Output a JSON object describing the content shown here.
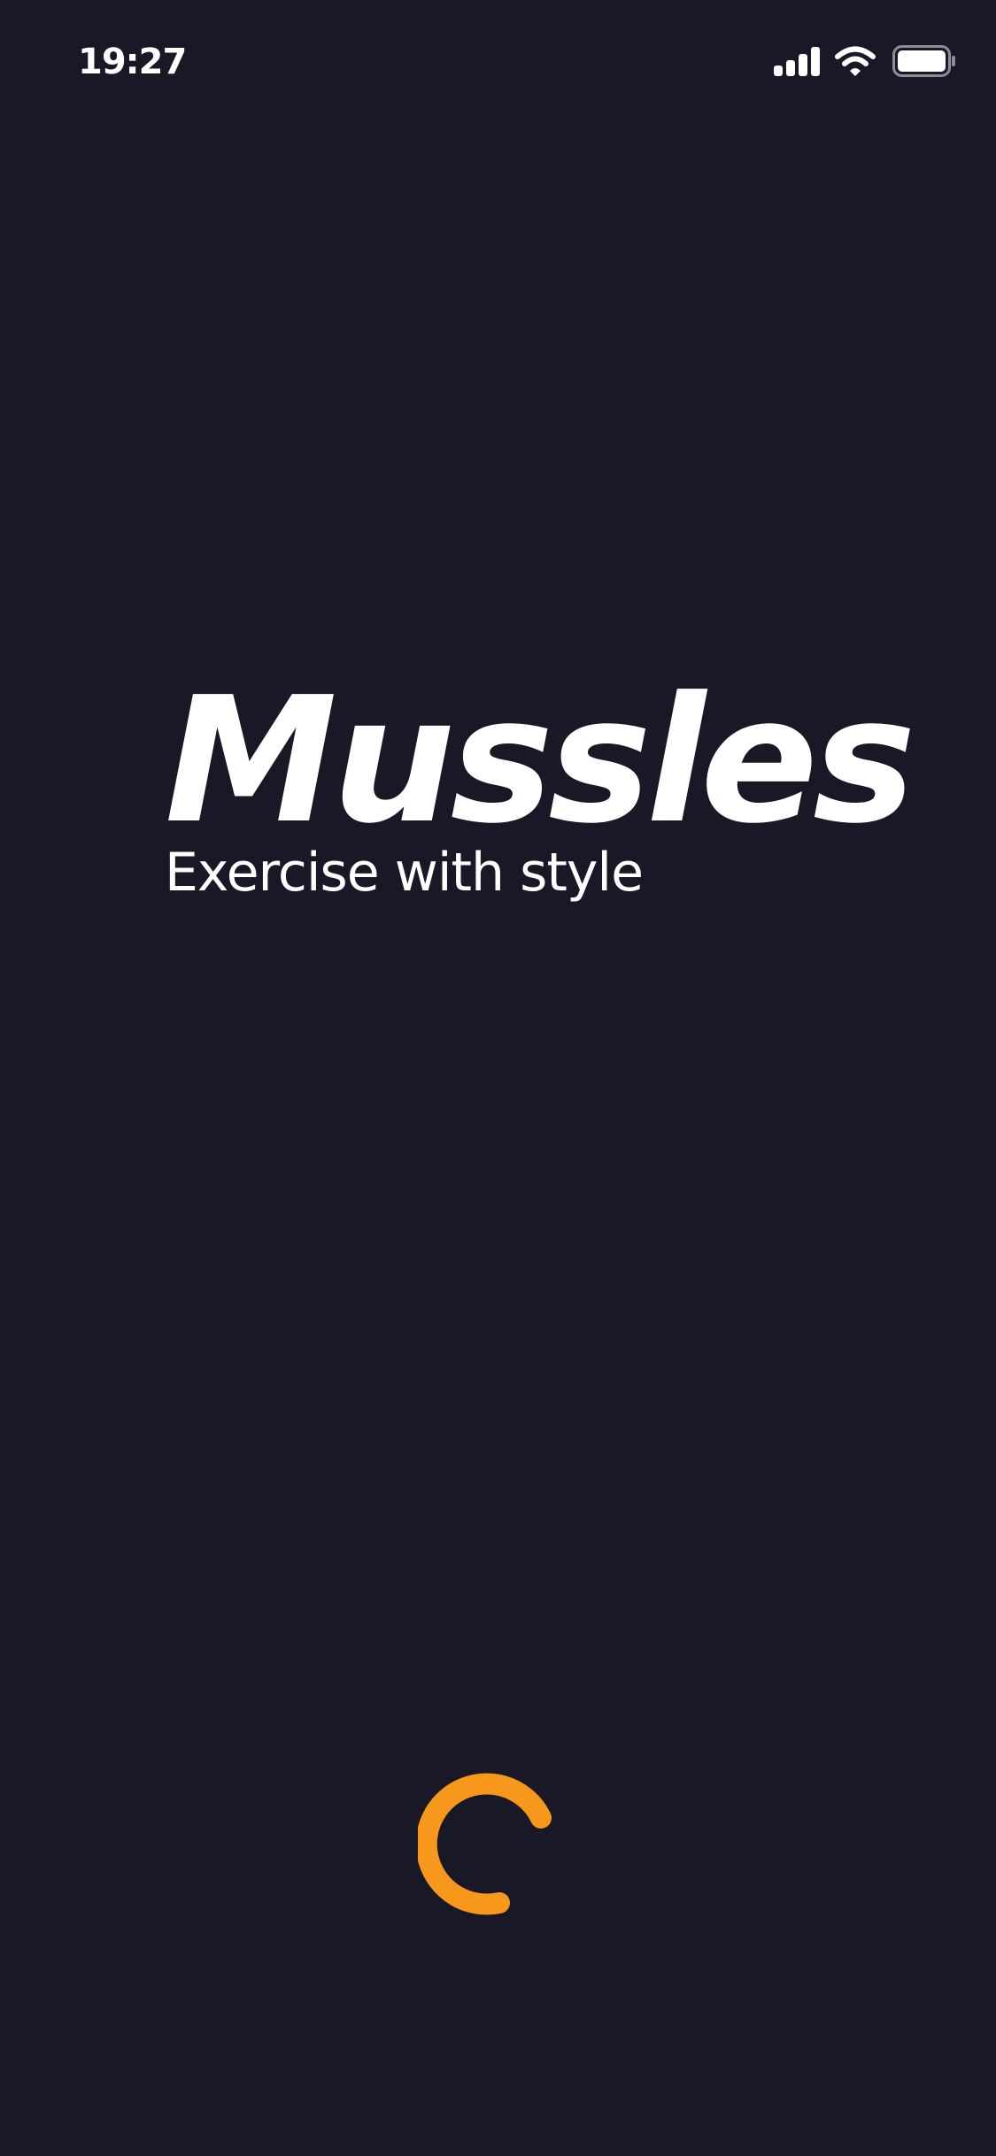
{
  "status_bar": {
    "time": "19:27",
    "icons": [
      "cellular-signal-icon",
      "wifi-icon",
      "battery-icon"
    ]
  },
  "splash": {
    "app_name": "Mussles",
    "tagline": "Exercise with style",
    "loading_indicator": "spinner"
  },
  "colors": {
    "background": "#181826",
    "text": "#ffffff",
    "accent": "#F7981C"
  }
}
